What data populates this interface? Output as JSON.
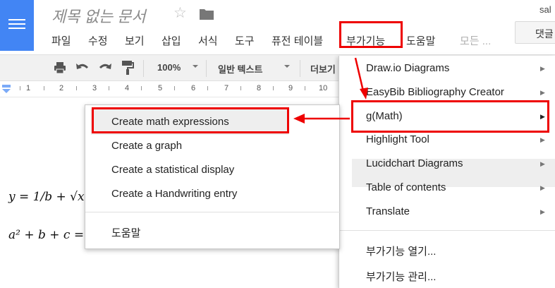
{
  "header": {
    "doc_title": "제목 없는 문서",
    "user_short": "sal",
    "comment_button": "댓글"
  },
  "menubar": {
    "items": [
      "파일",
      "수정",
      "보기",
      "삽입",
      "서식",
      "도구",
      "퓨전 테이블",
      "부가기능",
      "도움말"
    ],
    "more": "모든 ..."
  },
  "toolbar": {
    "zoom": "100%",
    "style": "일반 텍스트",
    "more": "더보기"
  },
  "ruler": {
    "numbers": [
      "1",
      "2",
      "3",
      "4",
      "5",
      "6",
      "7",
      "8",
      "9",
      "10"
    ]
  },
  "document": {
    "math_line1": "y = 1/b + √x",
    "math_line2": "a² + b + c ="
  },
  "addons_menu": {
    "items": [
      "Draw.io Diagrams",
      "EasyBib Bibliography Creator",
      "g(Math)",
      "Highlight Tool",
      "Lucidchart Diagrams",
      "Table of contents",
      "Translate"
    ],
    "get_addons": "부가기능 열기...",
    "manage_addons": "부가기능 관리..."
  },
  "gmath_submenu": {
    "items": [
      "Create math expressions",
      "Create a graph",
      "Create a statistical display",
      "Create a Handwriting entry"
    ],
    "help": "도움말"
  },
  "colors": {
    "brand_blue": "#4285f4",
    "annotation_red": "#ee0000"
  }
}
